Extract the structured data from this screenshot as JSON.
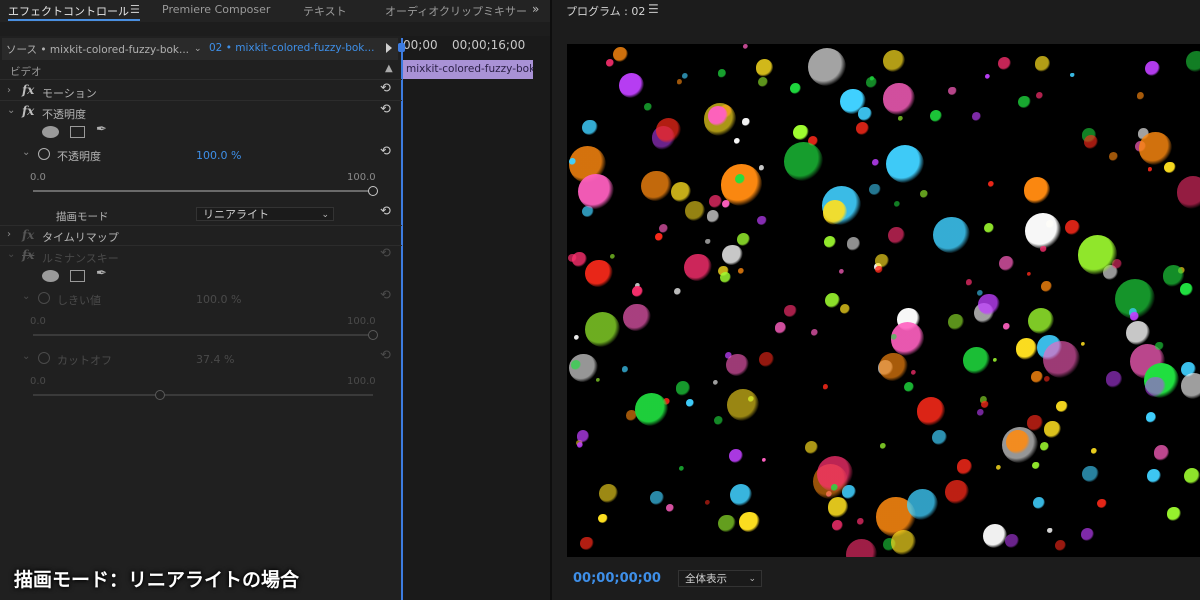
{
  "tabs": [
    {
      "label": "エフェクトコントロール",
      "active": true
    },
    {
      "label": "Premiere Composer",
      "active": false
    },
    {
      "label": "テキスト",
      "active": false
    },
    {
      "label": "オーディオクリップミキサー",
      "active": false
    }
  ],
  "tab_menu_icon": "hamburger-menu-icon",
  "overflow_icon": "double-chevron-right-icon",
  "source": {
    "master": "ソース • mixkit-colored-fuzzy-bok...",
    "sequence_clip": "02 • mixkit-colored-fuzzy-bok..."
  },
  "timeline": {
    "timecode_start": "00;00",
    "timecode_mark": "00;00;16;00",
    "clip_label": "mixkit-colored-fuzzy-bokeh"
  },
  "effects": {
    "section": "ビデオ",
    "motion": "モーション",
    "opacity": {
      "name": "不透明度",
      "param_label": "不透明度",
      "value": "100.0 %",
      "min": "0.0",
      "max": "100.0",
      "slider_fraction": 1.0,
      "blend_label": "描画モード",
      "blend_value": "リニアライト"
    },
    "time_remap": "タイムリマップ",
    "luma_key": {
      "name": "ルミナンスキー",
      "threshold_label": "しきい値",
      "threshold_value": "100.0 %",
      "threshold_min": "0.0",
      "threshold_max": "100.0",
      "threshold_fraction": 1.0,
      "cutoff_label": "カットオフ",
      "cutoff_value": "37.4 %",
      "cutoff_min": "0.0",
      "cutoff_max": "100.0",
      "cutoff_fraction": 0.374
    }
  },
  "caption": "描画モード：リニアライトの場合",
  "program": {
    "title": "プログラム : 02",
    "timecode": "00;00;00;00",
    "zoom": "全体表示"
  },
  "colors": {
    "accent_blue": "#3e8fe8",
    "clip_purple": "#a992d6"
  }
}
